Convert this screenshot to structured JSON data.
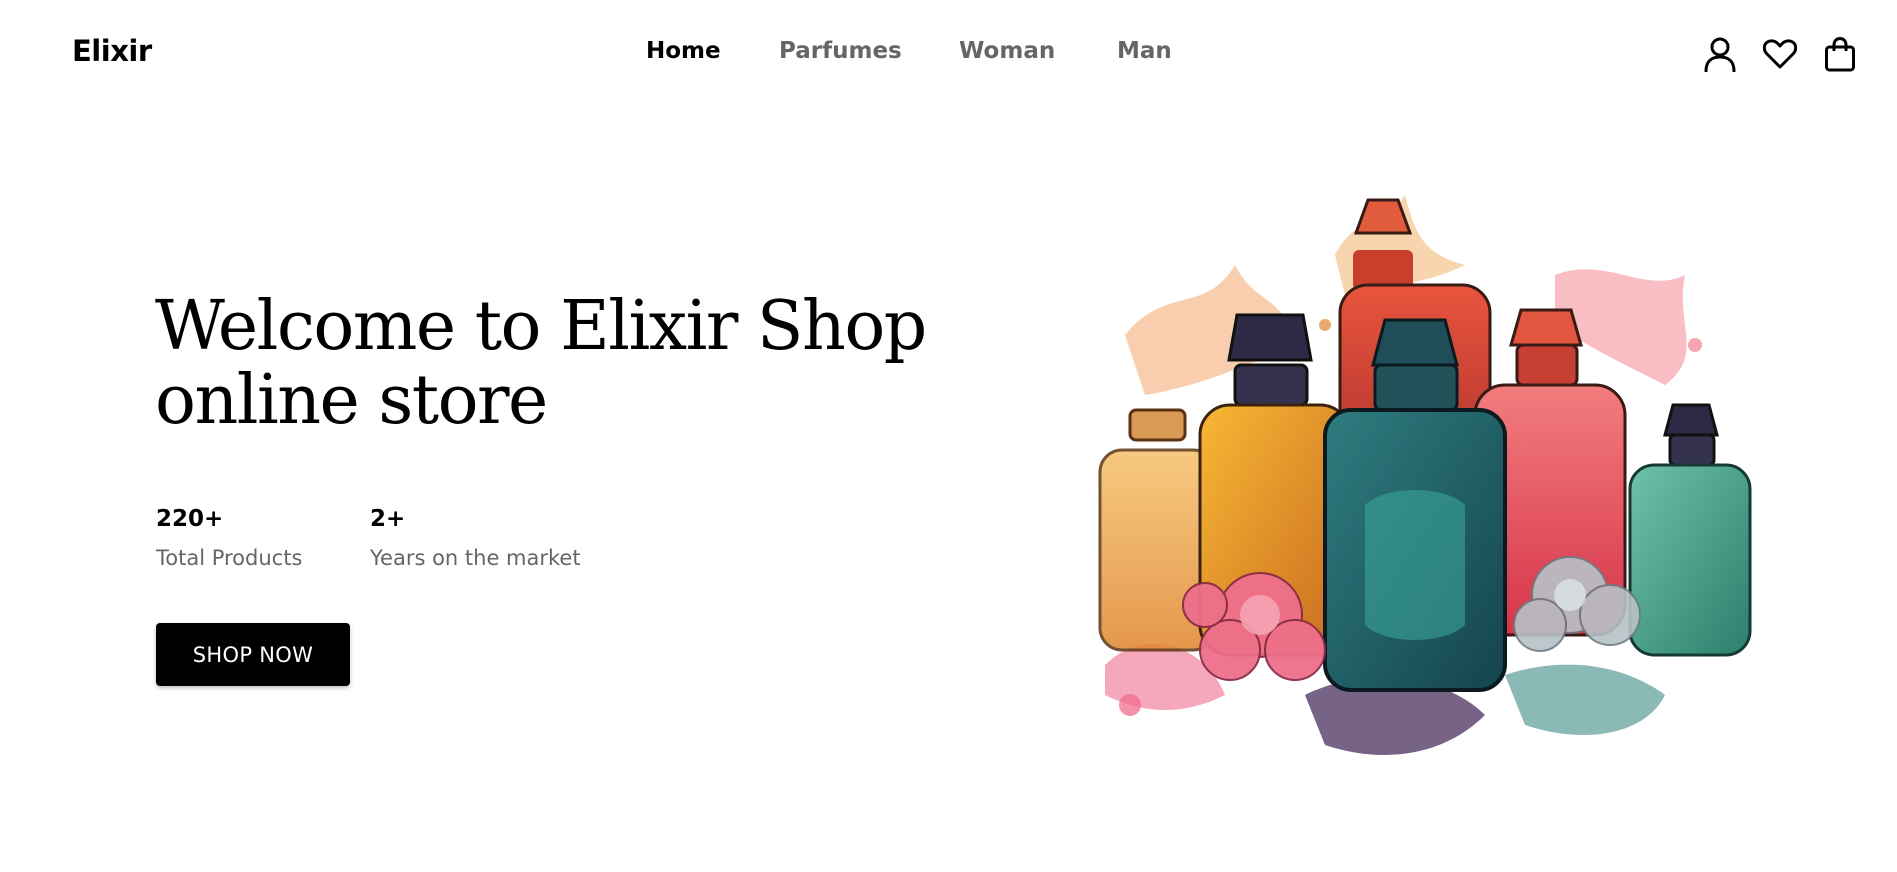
{
  "brand": {
    "logo_text": "Elixir"
  },
  "nav": {
    "links": [
      {
        "label": "Home",
        "active": true
      },
      {
        "label": "Parfumes",
        "active": false
      },
      {
        "label": "Woman",
        "active": false
      },
      {
        "label": "Man",
        "active": false
      }
    ],
    "icons": [
      "user-icon",
      "heart-icon",
      "shopping-bag-icon"
    ]
  },
  "hero": {
    "title_line1": "Welcome to Elixir Shop",
    "title_line2": "online store",
    "stats": [
      {
        "value": "220+",
        "label": "Total Products"
      },
      {
        "value": "2+",
        "label": "Years on the market"
      }
    ],
    "cta_label": "SHOP NOW",
    "image_subject": "perfume-bottles-illustration"
  },
  "colors": {
    "text_primary": "#000000",
    "text_muted": "#666666",
    "button_bg": "#000000",
    "button_text": "#ffffff",
    "background": "#ffffff"
  }
}
